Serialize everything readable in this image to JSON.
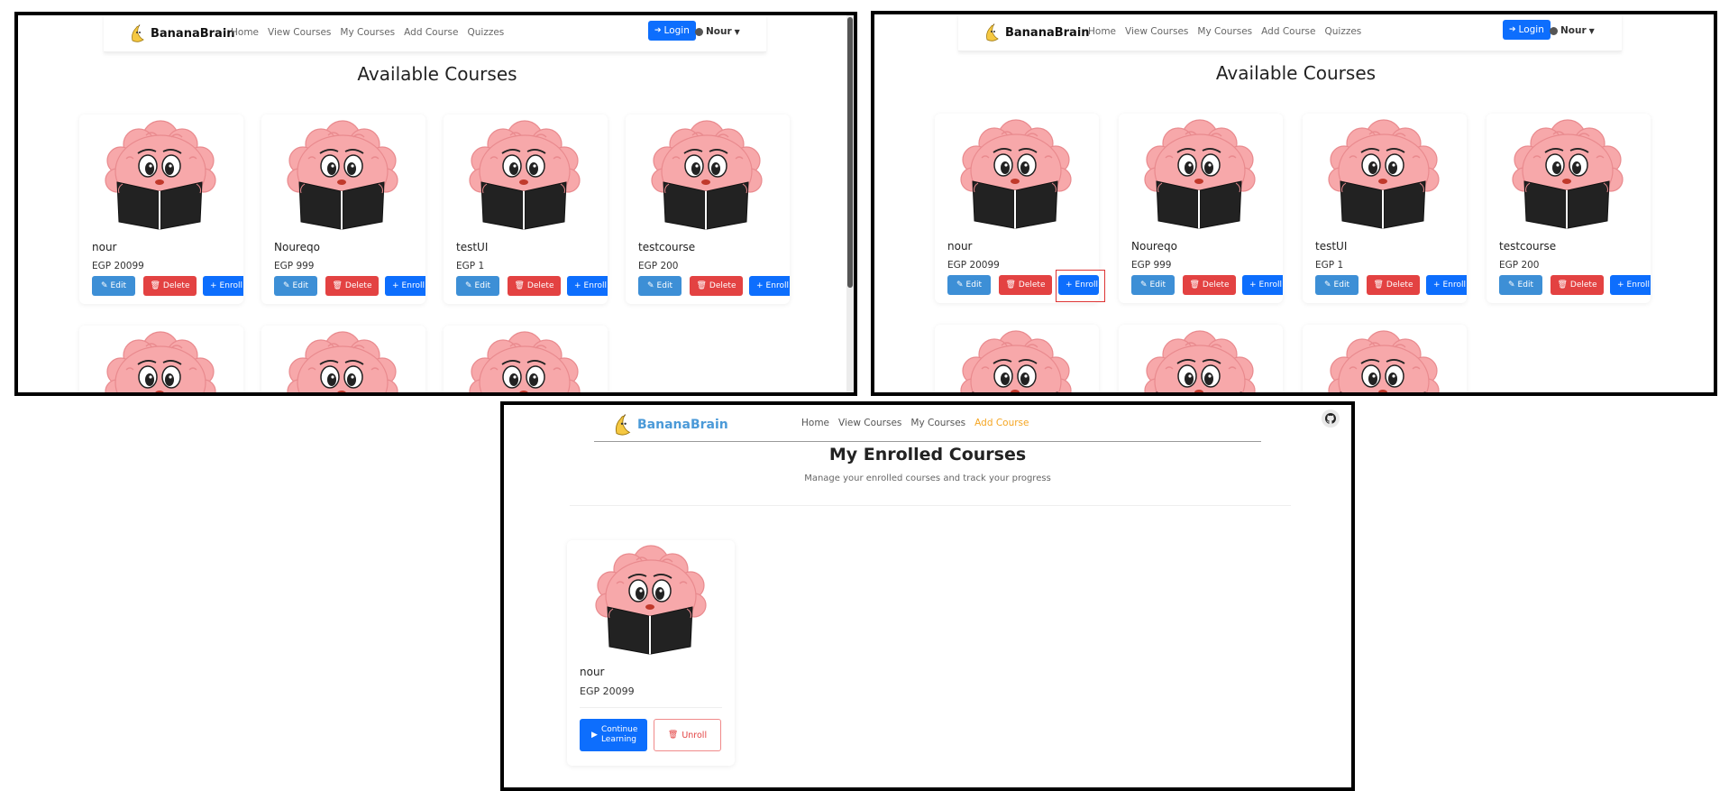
{
  "brand": {
    "name": "BananaBrain"
  },
  "nav": {
    "links": [
      "Home",
      "View Courses",
      "My Courses",
      "Add Course",
      "Quizzes"
    ],
    "login": "Login",
    "user": "Nour"
  },
  "available": {
    "title": "Available Courses",
    "buttons": {
      "edit": "Edit",
      "delete": "Delete",
      "enroll": "Enroll"
    },
    "courses": [
      {
        "name": "nour",
        "price": "EGP 20099"
      },
      {
        "name": "Noureqo",
        "price": "EGP 999"
      },
      {
        "name": "testUI",
        "price": "EGP 1"
      },
      {
        "name": "testcourse",
        "price": "EGP 200"
      }
    ]
  },
  "enrolled": {
    "nav_links": [
      "Home",
      "View Courses",
      "My Courses",
      "Add Course"
    ],
    "title": "My Enrolled Courses",
    "subtitle": "Manage your enrolled courses and track your progress",
    "course": {
      "name": "nour",
      "price": "EGP 20099"
    },
    "continue_label": "Continue Learning",
    "unroll_label": "Unroll"
  },
  "colors": {
    "primary": "#0d6efd",
    "edit": "#3d8fd6",
    "danger": "#e34242",
    "brand_accent": "#4b9ad8",
    "active_link": "#f5a623",
    "highlight": "#dd3333"
  }
}
